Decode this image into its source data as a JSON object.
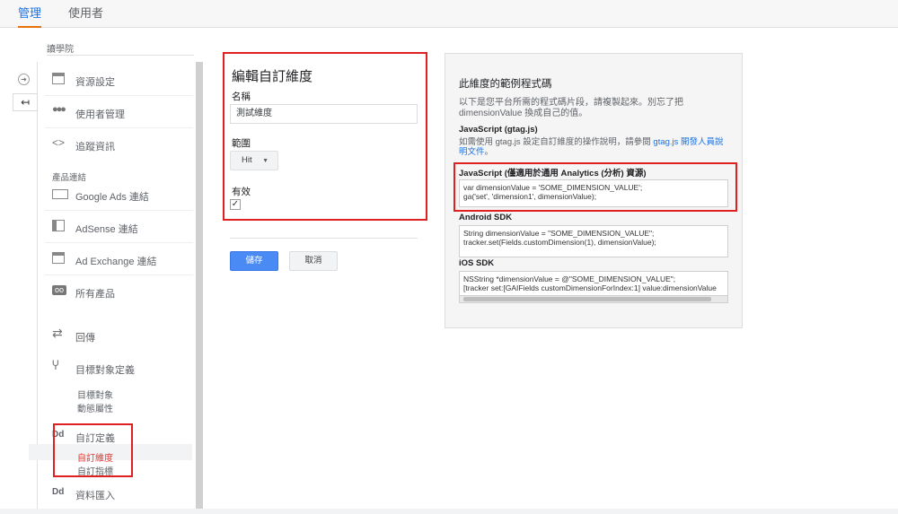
{
  "tabs": [
    {
      "label": "管理",
      "active": true
    },
    {
      "label": "使用者",
      "active": false
    }
  ],
  "breadcrumb": "讀學院",
  "sidebar": {
    "items": [
      {
        "label": "資源設定",
        "icon": "property-settings-icon"
      },
      {
        "label": "使用者管理",
        "icon": "users-icon"
      },
      {
        "label": "追蹤資訊",
        "icon": "code-brackets-icon"
      }
    ],
    "product_section_label": "產品連結",
    "product_items": [
      {
        "label": "Google Ads 連結",
        "icon": "google-ads-icon"
      },
      {
        "label": "AdSense 連結",
        "icon": "adsense-icon"
      },
      {
        "label": "Ad Exchange 連結",
        "icon": "ad-exchange-icon"
      },
      {
        "label": "所有產品",
        "icon": "all-products-icon"
      }
    ],
    "postback": {
      "label": "回傳",
      "icon": "postback-icon"
    },
    "audience_definitions": {
      "label": "目標對象定義",
      "icon": "audience-fork-icon"
    },
    "audience_subs": [
      "目標對象",
      "動態屬性"
    ],
    "custom_definitions": {
      "label": "自訂定義",
      "icon_text": "Dd"
    },
    "custom_subs": [
      {
        "label": "自訂維度",
        "active": true
      },
      {
        "label": "自訂指標",
        "active": false
      }
    ],
    "data_import": {
      "label": "資料匯入",
      "icon_text": "Dd"
    }
  },
  "form": {
    "title": "編輯自訂維度",
    "name_label": "名稱",
    "name_value": "測試維度",
    "scope_label": "範圍",
    "scope_value": "Hit",
    "active_label": "有效",
    "active_checked": "✓",
    "save_label": "儲存",
    "cancel_label": "取消"
  },
  "code_panel": {
    "title": "此維度的範例程式碼",
    "description": "以下是您平台所需的程式碼片段，請複製起來。別忘了把 dimensionValue 換成自己的值。",
    "gtag_heading": "JavaScript (gtag.js)",
    "gtag_text": "如需使用 gtag.js 設定自訂維度的操作說明，請參閱 ",
    "gtag_link": "gtag.js 開發人員說明文件",
    "gtag_suffix": "。",
    "analytics_heading": "JavaScript (僅適用於通用 Analytics (分析) 資源)",
    "analytics_code": [
      "var dimensionValue = 'SOME_DIMENSION_VALUE';",
      "ga('set', 'dimension1', dimensionValue);"
    ],
    "android_heading": "Android SDK",
    "android_code": [
      "String dimensionValue = \"SOME_DIMENSION_VALUE\";",
      "tracker.set(Fields.customDimension(1), dimensionValue);"
    ],
    "ios_heading": "iOS SDK",
    "ios_code": [
      "NSString *dimensionValue = @\"SOME_DIMENSION_VALUE\";",
      "[tracker set:[GAIFields customDimensionForIndex:1] value:dimensionValue"
    ]
  },
  "colors": {
    "accent": "#1a73e8",
    "highlight": "#e02020",
    "save_button": "#4a8af4"
  }
}
